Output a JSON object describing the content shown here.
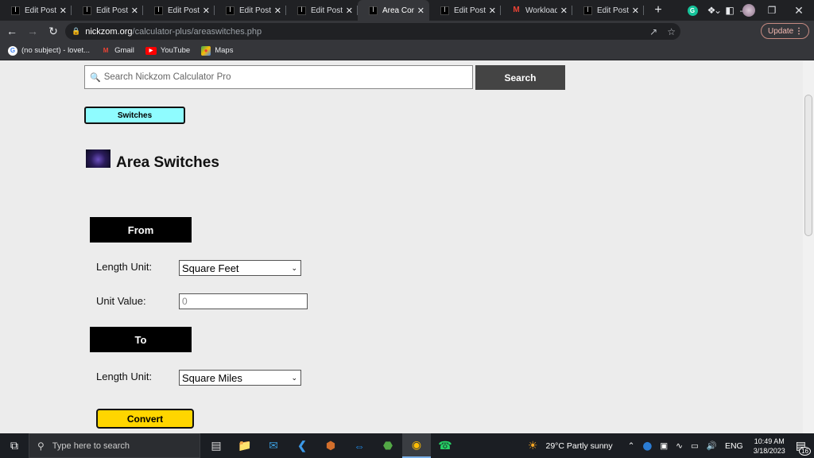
{
  "browser": {
    "tabs": [
      {
        "label": "Edit Post \"",
        "icon": "site-favicon",
        "active": false
      },
      {
        "label": "Edit Post \"",
        "icon": "site-favicon",
        "active": false
      },
      {
        "label": "Edit Post \"",
        "icon": "site-favicon",
        "active": false
      },
      {
        "label": "Edit Post \"",
        "icon": "site-favicon",
        "active": false
      },
      {
        "label": "Edit Post \"",
        "icon": "site-favicon",
        "active": false
      },
      {
        "label": "Area Conve",
        "icon": "site-favicon",
        "active": true
      },
      {
        "label": "Edit Post \"",
        "icon": "site-favicon",
        "active": false
      },
      {
        "label": "Workload",
        "icon": "gmail-icon",
        "active": false
      },
      {
        "label": "Edit Post \"",
        "icon": "site-favicon",
        "active": false
      }
    ],
    "url_host": "nickzom.org",
    "url_path": "/calculator-plus/areaswitches.php",
    "update_label": "Update",
    "bookmarks": [
      {
        "label": "(no subject) - lovet...",
        "icon": "google-icon"
      },
      {
        "label": "Gmail",
        "icon": "gmail-icon"
      },
      {
        "label": "YouTube",
        "icon": "youtube-icon"
      },
      {
        "label": "Maps",
        "icon": "maps-icon"
      }
    ]
  },
  "page": {
    "search_placeholder": "Search Nickzom Calculator Pro",
    "search_button": "Search",
    "switches_button": "Switches",
    "title": "Area Switches",
    "from_header": "From",
    "to_header": "To",
    "from_unit_label": "Length Unit:",
    "from_unit_value": "Square Feet",
    "unit_value_label": "Unit Value:",
    "unit_value_placeholder": "0",
    "to_unit_label": "Length Unit:",
    "to_unit_value": "Square Miles",
    "convert_button": "Convert"
  },
  "taskbar": {
    "search_placeholder": "Type here to search",
    "weather": "29°C  Partly sunny",
    "language": "ENG",
    "time": "10:49 AM",
    "date": "3/18/2023",
    "notifications": "16"
  }
}
